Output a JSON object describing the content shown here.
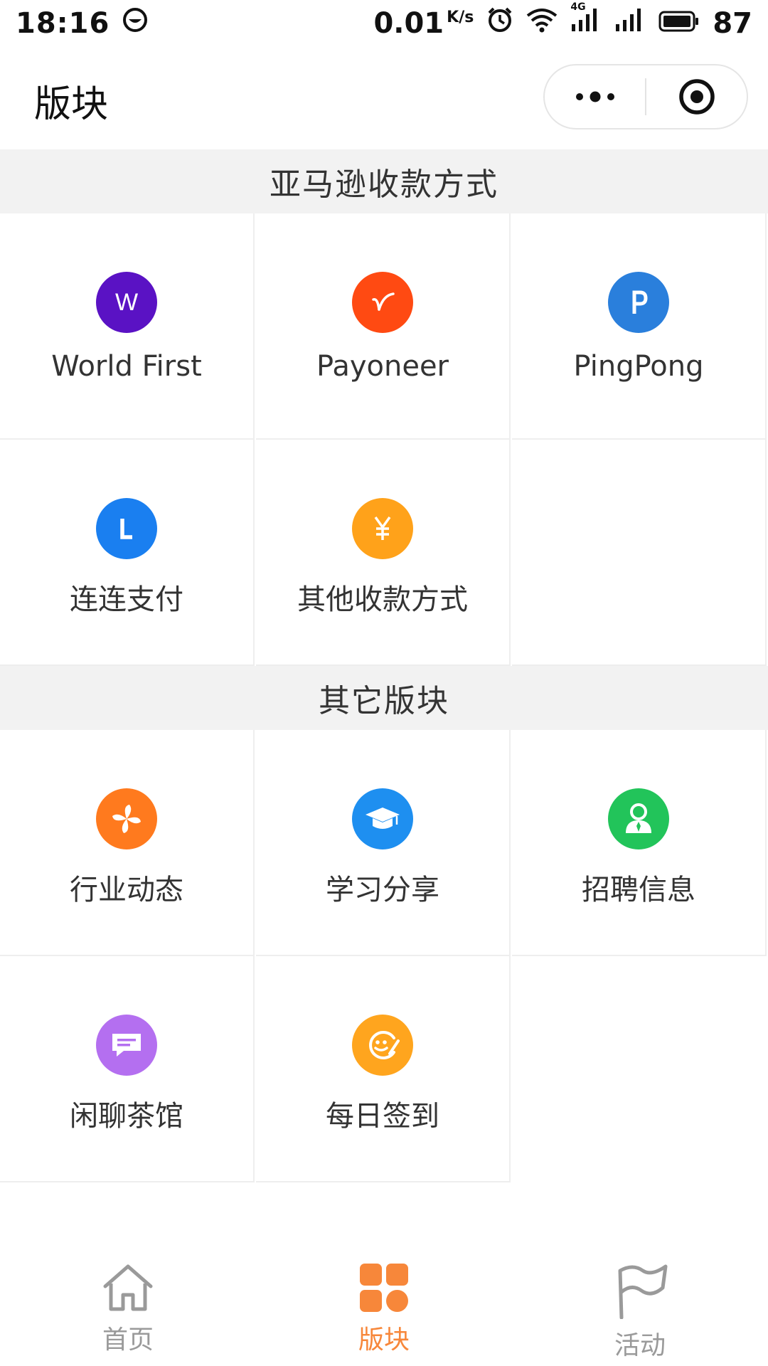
{
  "status_bar": {
    "time": "18:16",
    "speed": "0.01",
    "speed_unit": "K/s",
    "network": "4G",
    "battery": "87"
  },
  "header": {
    "title": "版块"
  },
  "sections": [
    {
      "title": "亚马逊收款方式",
      "items": [
        {
          "label": "World First",
          "icon": "world-first-icon",
          "color": "#5a12c4"
        },
        {
          "label": "Payoneer",
          "icon": "payoneer-icon",
          "color": "#ff4a12"
        },
        {
          "label": "PingPong",
          "icon": "pingpong-icon",
          "color": "#2a7fdc"
        },
        {
          "label": "连连支付",
          "icon": "lianlian-icon",
          "color": "#1a7ff0"
        },
        {
          "label": "其他收款方式",
          "icon": "yuan-icon",
          "color": "#ffa21a"
        }
      ]
    },
    {
      "title": "其它版块",
      "items": [
        {
          "label": "行业动态",
          "icon": "pinwheel-icon",
          "color": "#ff7a1e"
        },
        {
          "label": "学习分享",
          "icon": "graduation-cap-icon",
          "color": "#1e8ff0"
        },
        {
          "label": "招聘信息",
          "icon": "recruit-person-icon",
          "color": "#22c45a"
        },
        {
          "label": "闲聊茶馆",
          "icon": "chat-bubble-icon",
          "color": "#b46ff0"
        },
        {
          "label": "每日签到",
          "icon": "smile-check-icon",
          "color": "#ffa51e"
        }
      ]
    }
  ],
  "tabs": [
    {
      "label": "首页",
      "icon": "home-icon",
      "active": false
    },
    {
      "label": "版块",
      "icon": "grid-blocks-icon",
      "active": true
    },
    {
      "label": "活动",
      "icon": "flag-icon",
      "active": false
    }
  ],
  "colors": {
    "accent": "#f7873a",
    "tab_inactive": "#9a9a9a",
    "section_bg": "#f2f2f2"
  }
}
